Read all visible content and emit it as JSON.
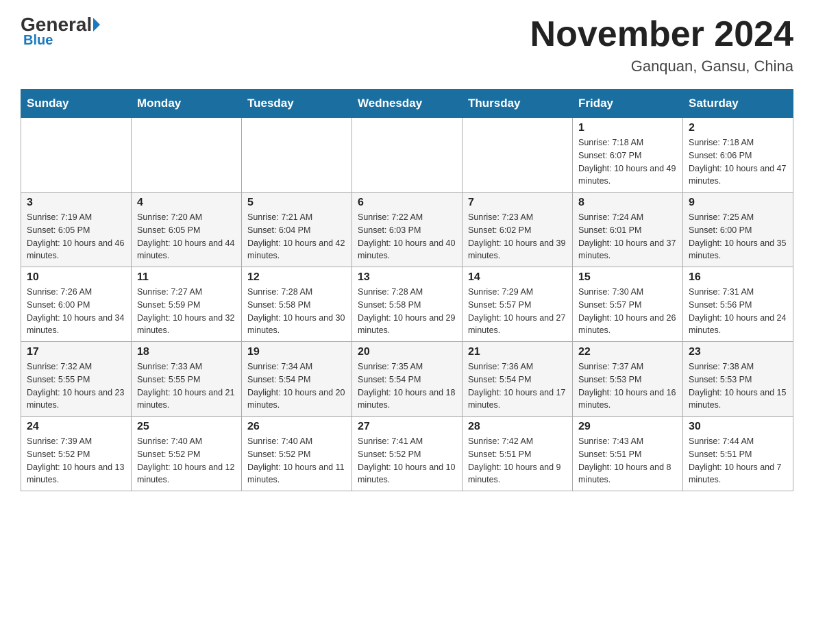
{
  "header": {
    "logo_general": "General",
    "logo_blue": "Blue",
    "month_title": "November 2024",
    "location": "Ganquan, Gansu, China"
  },
  "days_of_week": [
    "Sunday",
    "Monday",
    "Tuesday",
    "Wednesday",
    "Thursday",
    "Friday",
    "Saturday"
  ],
  "weeks": [
    [
      {
        "day": "",
        "info": ""
      },
      {
        "day": "",
        "info": ""
      },
      {
        "day": "",
        "info": ""
      },
      {
        "day": "",
        "info": ""
      },
      {
        "day": "",
        "info": ""
      },
      {
        "day": "1",
        "info": "Sunrise: 7:18 AM\nSunset: 6:07 PM\nDaylight: 10 hours and 49 minutes."
      },
      {
        "day": "2",
        "info": "Sunrise: 7:18 AM\nSunset: 6:06 PM\nDaylight: 10 hours and 47 minutes."
      }
    ],
    [
      {
        "day": "3",
        "info": "Sunrise: 7:19 AM\nSunset: 6:05 PM\nDaylight: 10 hours and 46 minutes."
      },
      {
        "day": "4",
        "info": "Sunrise: 7:20 AM\nSunset: 6:05 PM\nDaylight: 10 hours and 44 minutes."
      },
      {
        "day": "5",
        "info": "Sunrise: 7:21 AM\nSunset: 6:04 PM\nDaylight: 10 hours and 42 minutes."
      },
      {
        "day": "6",
        "info": "Sunrise: 7:22 AM\nSunset: 6:03 PM\nDaylight: 10 hours and 40 minutes."
      },
      {
        "day": "7",
        "info": "Sunrise: 7:23 AM\nSunset: 6:02 PM\nDaylight: 10 hours and 39 minutes."
      },
      {
        "day": "8",
        "info": "Sunrise: 7:24 AM\nSunset: 6:01 PM\nDaylight: 10 hours and 37 minutes."
      },
      {
        "day": "9",
        "info": "Sunrise: 7:25 AM\nSunset: 6:00 PM\nDaylight: 10 hours and 35 minutes."
      }
    ],
    [
      {
        "day": "10",
        "info": "Sunrise: 7:26 AM\nSunset: 6:00 PM\nDaylight: 10 hours and 34 minutes."
      },
      {
        "day": "11",
        "info": "Sunrise: 7:27 AM\nSunset: 5:59 PM\nDaylight: 10 hours and 32 minutes."
      },
      {
        "day": "12",
        "info": "Sunrise: 7:28 AM\nSunset: 5:58 PM\nDaylight: 10 hours and 30 minutes."
      },
      {
        "day": "13",
        "info": "Sunrise: 7:28 AM\nSunset: 5:58 PM\nDaylight: 10 hours and 29 minutes."
      },
      {
        "day": "14",
        "info": "Sunrise: 7:29 AM\nSunset: 5:57 PM\nDaylight: 10 hours and 27 minutes."
      },
      {
        "day": "15",
        "info": "Sunrise: 7:30 AM\nSunset: 5:57 PM\nDaylight: 10 hours and 26 minutes."
      },
      {
        "day": "16",
        "info": "Sunrise: 7:31 AM\nSunset: 5:56 PM\nDaylight: 10 hours and 24 minutes."
      }
    ],
    [
      {
        "day": "17",
        "info": "Sunrise: 7:32 AM\nSunset: 5:55 PM\nDaylight: 10 hours and 23 minutes."
      },
      {
        "day": "18",
        "info": "Sunrise: 7:33 AM\nSunset: 5:55 PM\nDaylight: 10 hours and 21 minutes."
      },
      {
        "day": "19",
        "info": "Sunrise: 7:34 AM\nSunset: 5:54 PM\nDaylight: 10 hours and 20 minutes."
      },
      {
        "day": "20",
        "info": "Sunrise: 7:35 AM\nSunset: 5:54 PM\nDaylight: 10 hours and 18 minutes."
      },
      {
        "day": "21",
        "info": "Sunrise: 7:36 AM\nSunset: 5:54 PM\nDaylight: 10 hours and 17 minutes."
      },
      {
        "day": "22",
        "info": "Sunrise: 7:37 AM\nSunset: 5:53 PM\nDaylight: 10 hours and 16 minutes."
      },
      {
        "day": "23",
        "info": "Sunrise: 7:38 AM\nSunset: 5:53 PM\nDaylight: 10 hours and 15 minutes."
      }
    ],
    [
      {
        "day": "24",
        "info": "Sunrise: 7:39 AM\nSunset: 5:52 PM\nDaylight: 10 hours and 13 minutes."
      },
      {
        "day": "25",
        "info": "Sunrise: 7:40 AM\nSunset: 5:52 PM\nDaylight: 10 hours and 12 minutes."
      },
      {
        "day": "26",
        "info": "Sunrise: 7:40 AM\nSunset: 5:52 PM\nDaylight: 10 hours and 11 minutes."
      },
      {
        "day": "27",
        "info": "Sunrise: 7:41 AM\nSunset: 5:52 PM\nDaylight: 10 hours and 10 minutes."
      },
      {
        "day": "28",
        "info": "Sunrise: 7:42 AM\nSunset: 5:51 PM\nDaylight: 10 hours and 9 minutes."
      },
      {
        "day": "29",
        "info": "Sunrise: 7:43 AM\nSunset: 5:51 PM\nDaylight: 10 hours and 8 minutes."
      },
      {
        "day": "30",
        "info": "Sunrise: 7:44 AM\nSunset: 5:51 PM\nDaylight: 10 hours and 7 minutes."
      }
    ]
  ]
}
